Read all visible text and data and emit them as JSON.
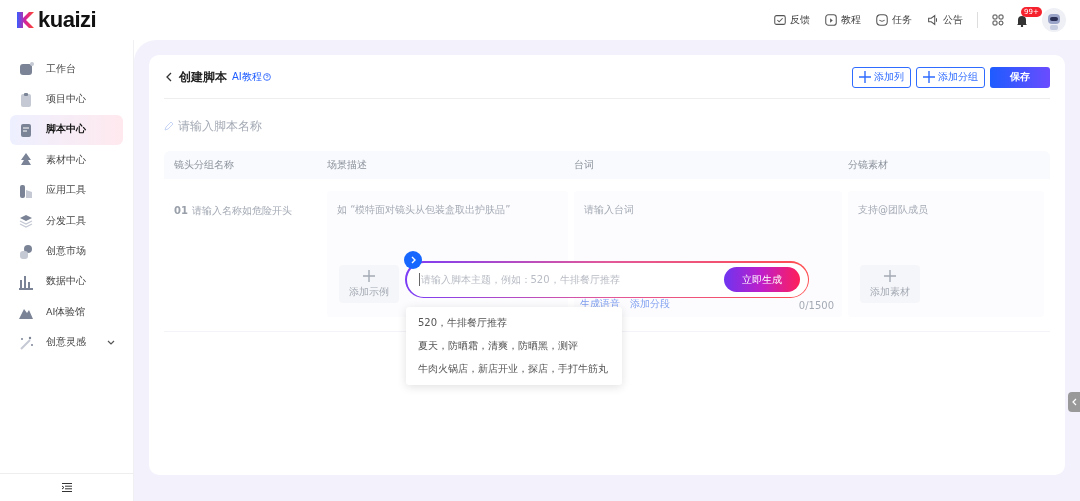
{
  "logo": {
    "text": "kuaizi"
  },
  "top_nav": [
    {
      "label": "反馈",
      "kind": "feedback"
    },
    {
      "label": "教程",
      "kind": "tutorial"
    },
    {
      "label": "任务",
      "kind": "task"
    },
    {
      "label": "公告",
      "kind": "notice"
    }
  ],
  "notifications": {
    "badge": "99+"
  },
  "sidebar": {
    "items": [
      {
        "label": "工作台",
        "selected": false,
        "kind": "link"
      },
      {
        "label": "项目中心",
        "selected": false,
        "kind": "link"
      },
      {
        "label": "脚本中心",
        "selected": true,
        "kind": "link"
      },
      {
        "label": "素材中心",
        "selected": false,
        "kind": "link"
      },
      {
        "label": "应用工具",
        "selected": false,
        "kind": "link"
      },
      {
        "label": "分发工具",
        "selected": false,
        "kind": "link"
      },
      {
        "label": "创意市场",
        "selected": false,
        "kind": "link"
      },
      {
        "label": "数据中心",
        "selected": false,
        "kind": "link"
      },
      {
        "label": "AI体验馆",
        "selected": false,
        "kind": "link"
      },
      {
        "label": "创意灵感",
        "selected": false,
        "kind": "group"
      }
    ]
  },
  "page": {
    "title": "创建脚本",
    "help_link": "AI教程",
    "buttons": [
      {
        "label": "添加列",
        "kind": "outline"
      },
      {
        "label": "添加分组",
        "kind": "outline"
      },
      {
        "label": "保存",
        "kind": "primary"
      }
    ],
    "name_field": {
      "placeholder": "请输入脚本名称"
    }
  },
  "table": {
    "columns": [
      "镜头分组名称",
      "场景描述",
      "台词",
      "分镜素材"
    ],
    "rows": [
      {
        "number": "01",
        "name_placeholder": "请输入名称如危险开头",
        "scene_placeholder": "如 “模特面对镜头从包装盒取出护肤品”",
        "scene_button": "添加示例",
        "line_placeholder": "请输入台词",
        "line_actions": [
          "生成语音",
          "添加分段"
        ],
        "line_count": "0/1500",
        "material_placeholder": "支持@团队成员",
        "material_button": "添加素材"
      }
    ]
  },
  "generator": {
    "placeholder": "请输入脚本主题，例如：520，牛排餐厅推荐",
    "button": "立即生成",
    "suggestions": [
      "520，牛排餐厅推荐",
      "夏天，防晒霜，清爽，防晒黑，测评",
      "牛肉火锅店，新店开业，探店，手打牛筋丸"
    ]
  }
}
